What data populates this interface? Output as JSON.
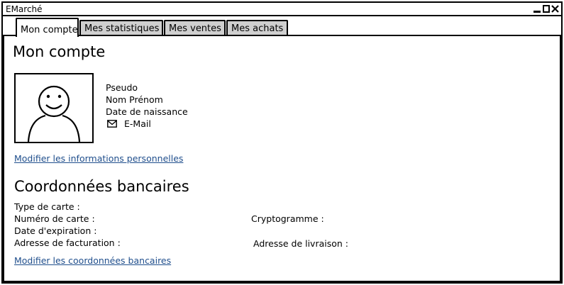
{
  "window": {
    "title": "EMarché"
  },
  "tabs": [
    "Mon compte",
    "Mes statistiques",
    "Mes ventes",
    "Mes achats"
  ],
  "account": {
    "heading": "Mon compte",
    "pseudo": "Pseudo",
    "name": "Nom Prénom",
    "birthdate": "Date de naissance",
    "email": "E-Mail",
    "edit_link": "Modifier les informations personnelles"
  },
  "bank": {
    "heading": "Coordonnées bancaires",
    "card_type": "Type de carte :",
    "card_number": "Numéro de carte :",
    "cryptogram": "Cryptogramme :",
    "expiry": "Date d'expiration :",
    "billing_address": "Adresse de facturation :",
    "delivery_address": "Adresse de livraison :",
    "edit_link": "Modifier les coordonnées bancaires"
  }
}
